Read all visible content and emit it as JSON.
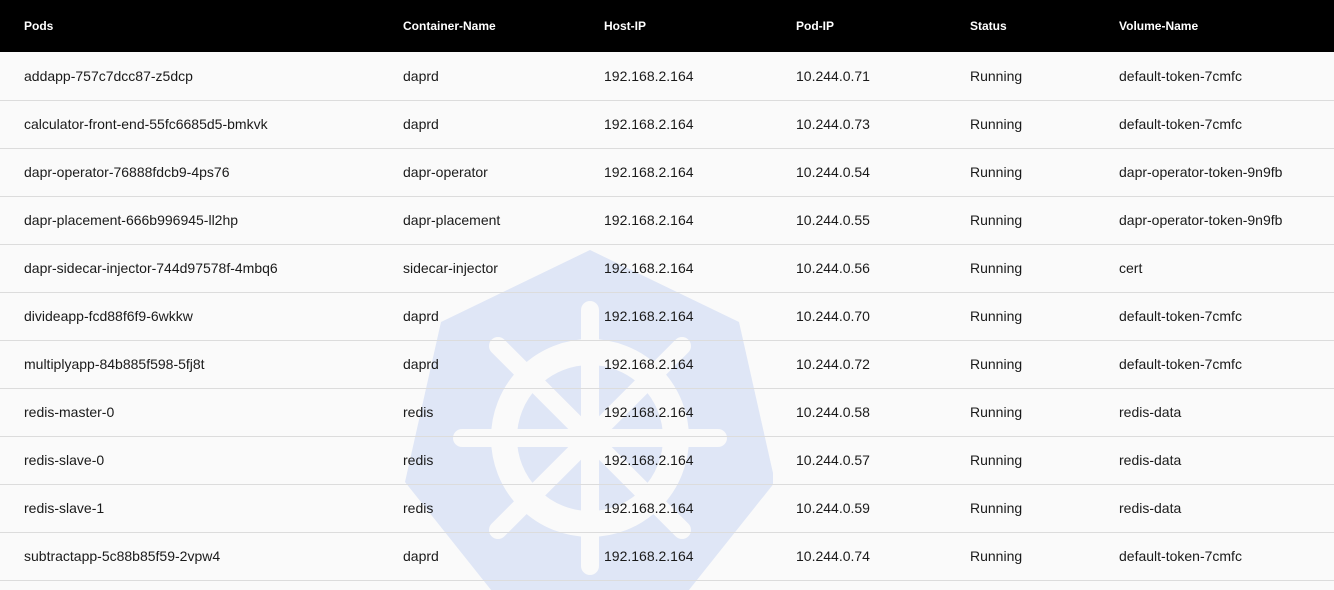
{
  "columns": [
    "Pods",
    "Container-Name",
    "Host-IP",
    "Pod-IP",
    "Status",
    "Volume-Name"
  ],
  "rows": [
    [
      "addapp-757c7dcc87-z5dcp",
      "daprd",
      "192.168.2.164",
      "10.244.0.71",
      "Running",
      "default-token-7cmfc"
    ],
    [
      "calculator-front-end-55fc6685d5-bmkvk",
      "daprd",
      "192.168.2.164",
      "10.244.0.73",
      "Running",
      "default-token-7cmfc"
    ],
    [
      "dapr-operator-76888fdcb9-4ps76",
      "dapr-operator",
      "192.168.2.164",
      "10.244.0.54",
      "Running",
      "dapr-operator-token-9n9fb"
    ],
    [
      "dapr-placement-666b996945-ll2hp",
      "dapr-placement",
      "192.168.2.164",
      "10.244.0.55",
      "Running",
      "dapr-operator-token-9n9fb"
    ],
    [
      "dapr-sidecar-injector-744d97578f-4mbq6",
      "sidecar-injector",
      "192.168.2.164",
      "10.244.0.56",
      "Running",
      "cert"
    ],
    [
      "divideapp-fcd88f6f9-6wkkw",
      "daprd",
      "192.168.2.164",
      "10.244.0.70",
      "Running",
      "default-token-7cmfc"
    ],
    [
      "multiplyapp-84b885f598-5fj8t",
      "daprd",
      "192.168.2.164",
      "10.244.0.72",
      "Running",
      "default-token-7cmfc"
    ],
    [
      "redis-master-0",
      "redis",
      "192.168.2.164",
      "10.244.0.58",
      "Running",
      "redis-data"
    ],
    [
      "redis-slave-0",
      "redis",
      "192.168.2.164",
      "10.244.0.57",
      "Running",
      "redis-data"
    ],
    [
      "redis-slave-1",
      "redis",
      "192.168.2.164",
      "10.244.0.59",
      "Running",
      "redis-data"
    ],
    [
      "subtractapp-5c88b85f59-2vpw4",
      "daprd",
      "192.168.2.164",
      "10.244.0.74",
      "Running",
      "default-token-7cmfc"
    ]
  ],
  "watermark": {
    "icon": "kubernetes-helm-icon",
    "color": "#c9d6f3"
  },
  "colors": {
    "header_bg": "#000000",
    "header_text": "#ffffff",
    "body_bg": "#fafafa",
    "row_border": "#dcdcdc"
  }
}
